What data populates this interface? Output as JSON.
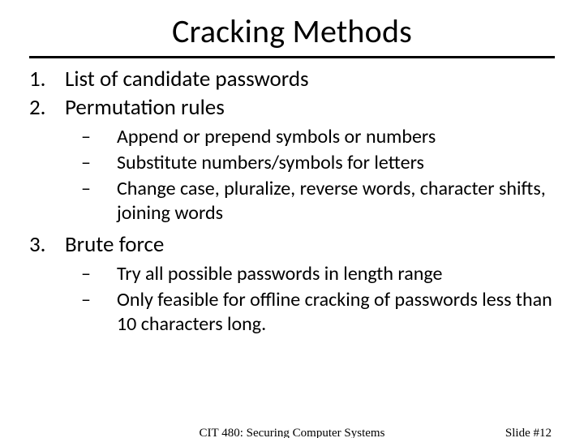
{
  "title": "Cracking Methods",
  "items": {
    "one": {
      "num": "1.",
      "text": "List of candidate passwords"
    },
    "two": {
      "num": "2.",
      "text": "Permutation rules"
    },
    "three": {
      "num": "3.",
      "text": "Brute force"
    }
  },
  "perm_sub": {
    "a": "Append or prepend symbols or numbers",
    "b": "Substitute numbers/symbols for letters",
    "c": "Change case, pluralize, reverse words, character shifts, joining words"
  },
  "brute_sub": {
    "a": "Try all possible passwords  in length range",
    "b": "Only feasible for offline cracking of passwords less than 10 characters long."
  },
  "dash": "–",
  "footer": {
    "course": "CIT 480: Securing Computer Systems",
    "slide": "Slide #12"
  }
}
